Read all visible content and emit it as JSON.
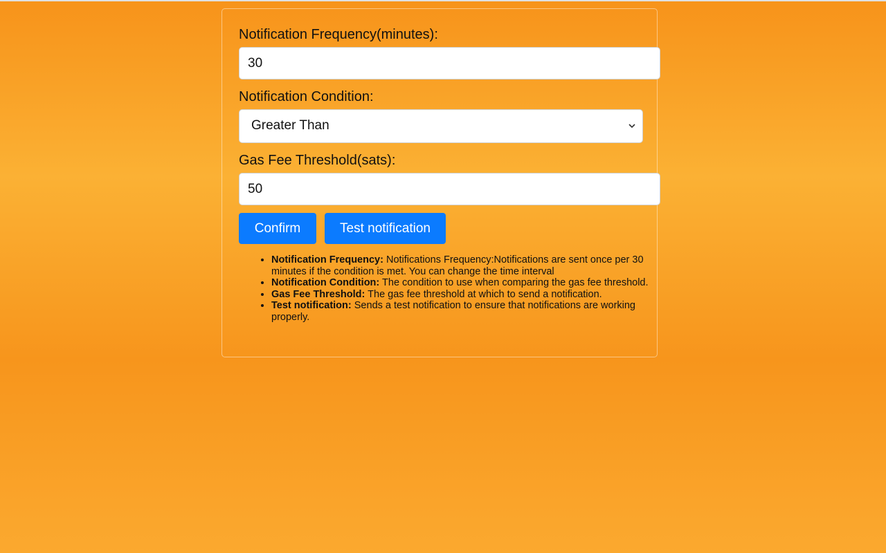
{
  "form": {
    "frequency": {
      "label": "Notification Frequency(minutes):",
      "value": "30"
    },
    "condition": {
      "label": "Notification Condition:",
      "selected": "Greater Than"
    },
    "threshold": {
      "label": "Gas Fee Threshold(sats):",
      "value": "50"
    },
    "buttons": {
      "confirm": "Confirm",
      "test": "Test notification"
    }
  },
  "help": [
    {
      "term": "Notification Frequency:",
      "desc": " Notifications Frequency:Notifications are sent once per 30 minutes if the condition is met. You can change the time interval"
    },
    {
      "term": "Notification Condition:",
      "desc": " The condition to use when comparing the gas fee threshold."
    },
    {
      "term": "Gas Fee Threshold:",
      "desc": " The gas fee threshold at which to send a notification."
    },
    {
      "term": "Test notification:",
      "desc": " Sends a test notification to ensure that notifications are working properly."
    }
  ],
  "colors": {
    "accent": "#0b7bff",
    "background": "#f7931a"
  },
  "icons": {
    "select_arrow": "chevron-down-icon"
  }
}
